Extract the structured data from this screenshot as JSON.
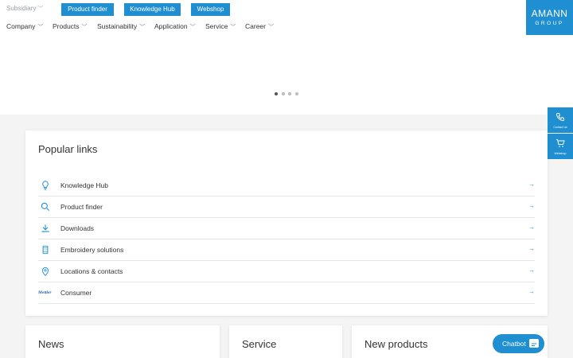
{
  "topbar": {
    "subsidiary_label": "Subsidiary",
    "buttons": [
      "Product finder",
      "Knowledge Hub",
      "Webshop"
    ]
  },
  "nav": {
    "items": [
      "Company",
      "Products",
      "Sustainability",
      "Application",
      "Service",
      "Career"
    ]
  },
  "logo": {
    "line1": "AMANN",
    "line2": "GROUP"
  },
  "carousel": {
    "slide_count": 4,
    "active_index": 0
  },
  "side": {
    "contact_label": "Contact us",
    "webshop_label": "Webshop"
  },
  "popular": {
    "title": "Popular links",
    "links": [
      {
        "label": "Knowledge Hub",
        "icon": "lightbulb-icon"
      },
      {
        "label": "Product finder",
        "icon": "search-icon"
      },
      {
        "label": "Downloads",
        "icon": "download-icon"
      },
      {
        "label": "Embroidery solutions",
        "icon": "thread-spool-icon"
      },
      {
        "label": "Locations & contacts",
        "icon": "location-pin-icon"
      },
      {
        "label": "Consumer",
        "icon": "mettler-logo",
        "logo_text": "Mettler"
      }
    ]
  },
  "sections": {
    "news": "News",
    "service": "Service",
    "new_products": "New products"
  },
  "chatbot": {
    "label": "Chatbot"
  },
  "colors": {
    "brand": "#1f8fd1",
    "text": "#333333",
    "muted": "#9aa0a6"
  }
}
